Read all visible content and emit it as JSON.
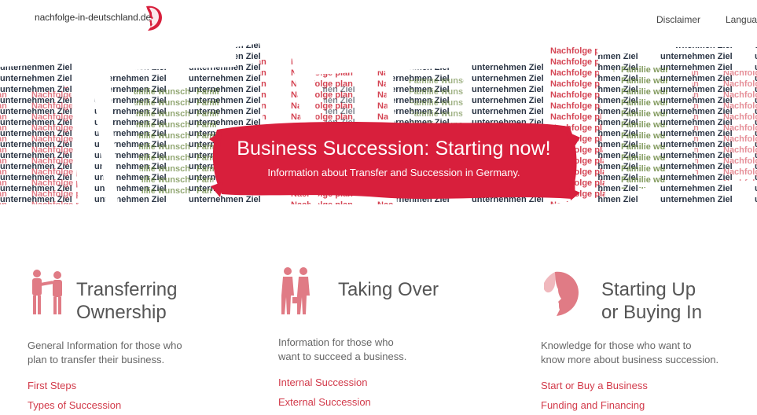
{
  "header": {
    "logo_text": "nachfolge-in-deutschland.de",
    "nav": [
      "Disclaimer",
      "Language"
    ]
  },
  "hero": {
    "title": "Business Succession: Starting now!",
    "subtitle": "Information about Transfer and Succession in Germany."
  },
  "columns": [
    {
      "title_line1": "Transferring",
      "title_line2": "Ownership",
      "icon": "handshake-icon",
      "desc_line1": "General Information for those who",
      "desc_line2": "plan to transfer their business.",
      "links": [
        "First Steps",
        "Types of Succession"
      ]
    },
    {
      "title_line1": "Taking Over",
      "title_line2": "",
      "icon": "people-walking-icon",
      "desc_line1": "Information for those who",
      "desc_line2": "want to succeed a business.",
      "links": [
        "Internal Succession",
        "External Succession"
      ]
    },
    {
      "title_line1": "Starting Up",
      "title_line2": "or Buying In",
      "icon": "head-profile-icon",
      "desc_line1": "Knowledge for those who want to",
      "desc_line2": "know more about business succession.",
      "links": [
        "Start or Buy a Business",
        "Funding and Financing"
      ]
    }
  ],
  "colors": {
    "accent": "#d23a4a",
    "banner": "#d81f3c",
    "wordcloud_dark": "#1f2a3a",
    "wordcloud_red": "#d23a4a",
    "wordcloud_green": "#5a7a2a"
  }
}
